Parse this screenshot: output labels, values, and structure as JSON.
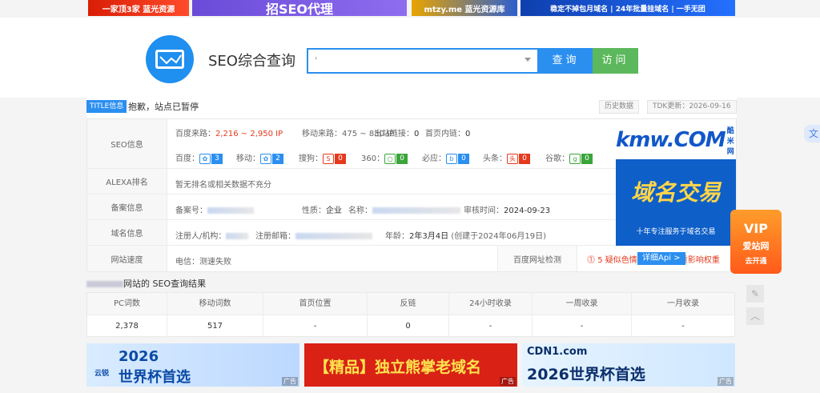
{
  "top_ads": [
    {
      "text": "一家顶3家  蓝光资源"
    },
    {
      "text": "招SEO代理"
    },
    {
      "text": "mtzy.me  蓝光资源库"
    },
    {
      "text": "稳定不掉包月域名 | 24年批量挂域名 | 一手无团"
    }
  ],
  "ad_mark": "广告",
  "header": {
    "title": "SEO综合查询",
    "search_value": "'",
    "query_button": "查询",
    "visit_button": "访问"
  },
  "title_row": {
    "tag": "TITLE信息",
    "text": "抱歉，站点已暂停",
    "history": "历史数据",
    "tdk": "TDK更新：2026-09-16"
  },
  "seo": {
    "label": "SEO信息",
    "baidu_source_label": "百度来路：",
    "baidu_source_value": "2,216 ~ 2,950 IP",
    "mobile_source_label": "移动来路：",
    "mobile_source_value": "475 ~ 830 IP",
    "outbound_label": "出站链接：",
    "outbound_value": "0",
    "home_links_label": "首页内链：",
    "home_links_value": "0",
    "weights": [
      {
        "label": "百度：",
        "value": "3",
        "color": "#2b8ff0"
      },
      {
        "label": "移动：",
        "value": "2",
        "color": "#2b8ff0"
      },
      {
        "label": "搜狗：",
        "value": "0",
        "color": "#e43a1e"
      },
      {
        "label": "360：",
        "value": "0",
        "color": "#3aa53a"
      },
      {
        "label": "必应：",
        "value": "0",
        "color": "#2b8ff0"
      },
      {
        "label": "头条：",
        "value": "0",
        "color": "#e43a1e"
      },
      {
        "label": "谷歌：",
        "value": "0",
        "color": "#3aa53a"
      }
    ]
  },
  "alexa": {
    "label": "ALEXA排名",
    "value": "暂无排名或相关数据不充分"
  },
  "icp": {
    "label": "备案信息",
    "number_label": "备案号：",
    "nature_label": "性质：",
    "nature_value": "企业",
    "name_label": "名称：",
    "audit_label": "审核时间：",
    "audit_value": "2024-09-23"
  },
  "domain": {
    "label": "域名信息",
    "registrant_label": "注册人/机构：",
    "email_label": "注册邮箱：",
    "age_label": "年龄：",
    "age_value": "2年3月4日",
    "created": "(创建于2024年06月19日)"
  },
  "speed": {
    "label": "网站速度",
    "value": "电信：测速失败",
    "check_label": "百度网址检测",
    "warning": "5 疑似色情博彩风险 严重影响权重",
    "api_button": "详细Api >"
  },
  "right_ad": {
    "brand": "kmw.COM",
    "brand_sub": "酷米网",
    "headline": "域名交易",
    "tagline": "十年专注服务于域名交易"
  },
  "vip": {
    "title": "VIP",
    "sub": "爱站网",
    "cta": "去开通"
  },
  "results": {
    "title_suffix": "网站的 SEO查询结果",
    "headers": [
      "PC词数",
      "移动词数",
      "首页位置",
      "反链",
      "24小时收录",
      "一周收录",
      "一月收录"
    ],
    "values": [
      "2,378",
      "517",
      "-",
      "0",
      "-",
      "-",
      "-"
    ]
  },
  "bottom_ads": [
    {
      "brand": "云锐",
      "text1": "2026",
      "text2": "世界杯首选"
    },
    {
      "text": "【精品】独立熊掌老域名"
    },
    {
      "brand": "CDN1.com",
      "text": "2026世界杯首选"
    }
  ],
  "icons": {
    "logo": "monitor-chart-icon",
    "dropdown": "chevron-down-icon",
    "translate": "translate-icon",
    "edit": "pencil-icon",
    "top": "arrow-up-icon"
  }
}
